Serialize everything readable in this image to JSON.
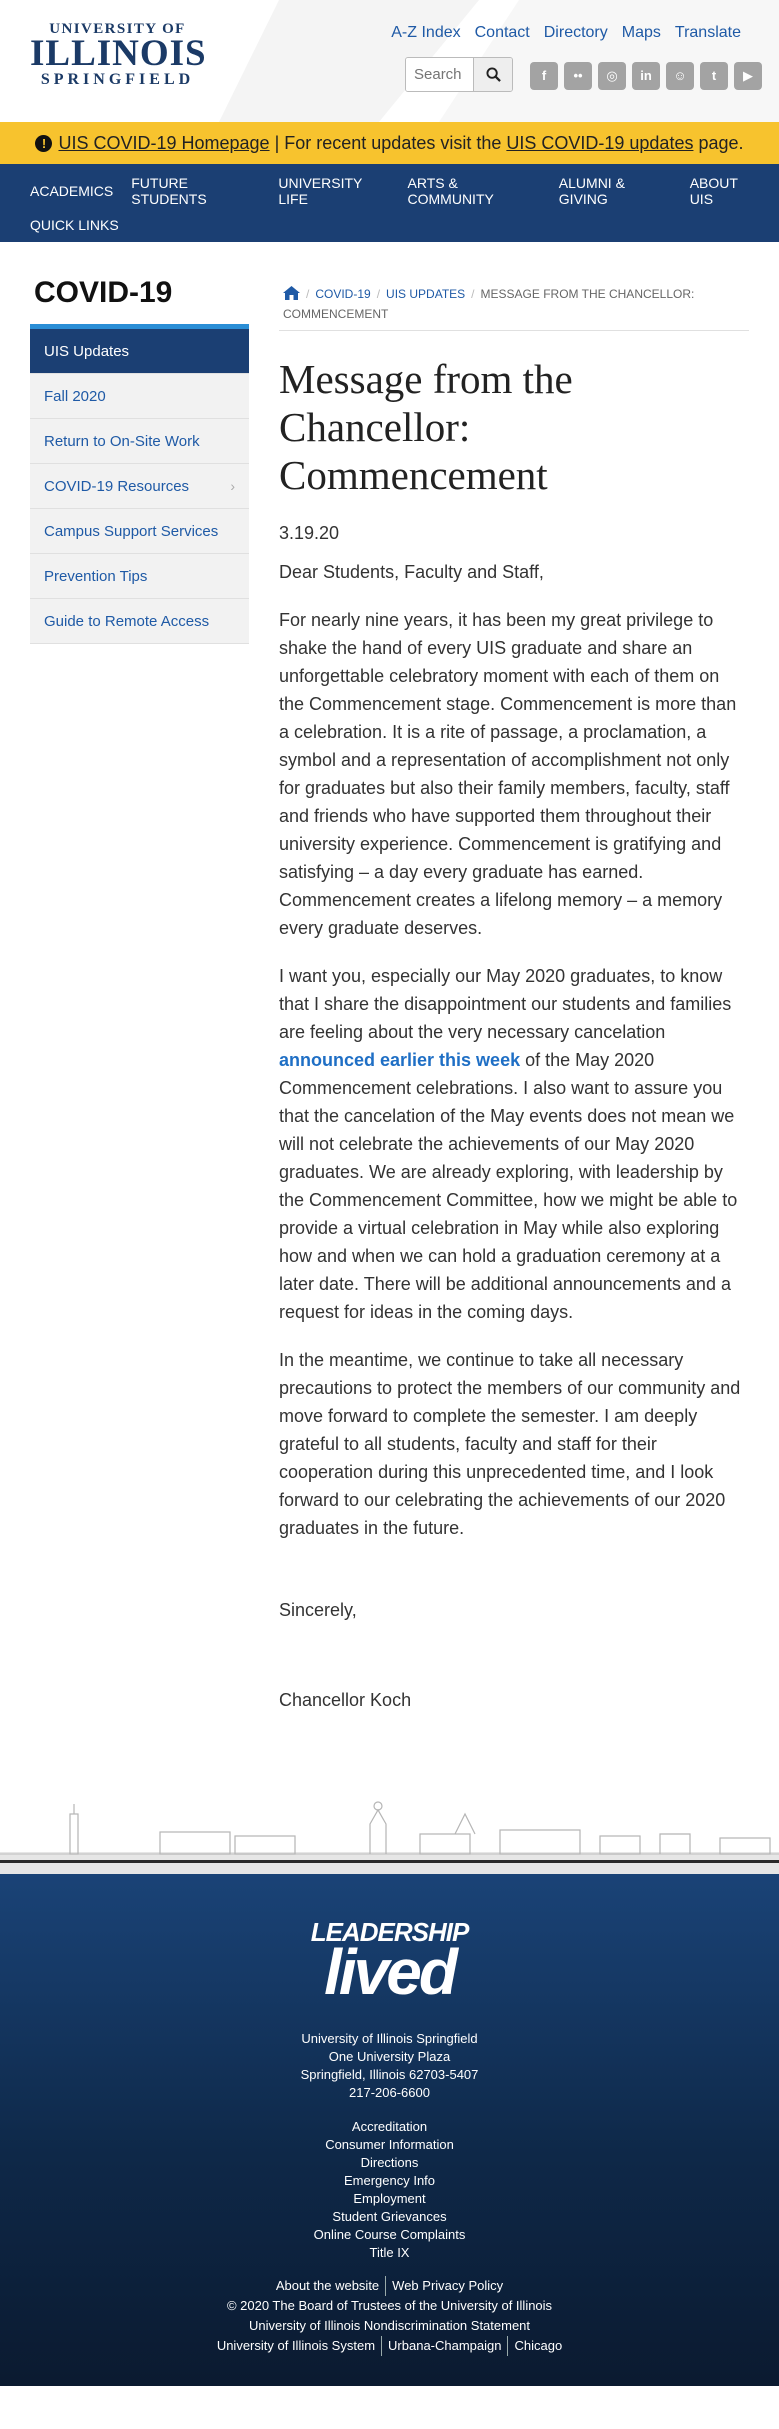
{
  "header": {
    "logo": {
      "line1": "UNIVERSITY OF",
      "line2": "ILLINOIS",
      "line3": "SPRINGFIELD"
    },
    "util_links": [
      "A-Z Index",
      "Contact",
      "Directory",
      "Maps",
      "Translate"
    ],
    "search": {
      "placeholder": "Search"
    },
    "social_icons": [
      "facebook-icon",
      "flickr-icon",
      "instagram-icon",
      "linkedin-icon",
      "snapchat-icon",
      "twitter-icon",
      "youtube-icon"
    ]
  },
  "alert": {
    "link1": "UIS COVID-19 Homepage",
    "mid": " | For recent updates visit the ",
    "link2": "UIS COVID-19 updates",
    "end": " page."
  },
  "mainnav": {
    "items": [
      "ACADEMICS",
      "FUTURE STUDENTS",
      "UNIVERSITY LIFE",
      "ARTS & COMMUNITY",
      "ALUMNI & GIVING",
      "ABOUT UIS"
    ],
    "quick": "QUICK LINKS"
  },
  "sidebar": {
    "title": "COVID-19",
    "items": [
      "UIS Updates",
      "Fall 2020",
      "Return to On-Site Work",
      "COVID-19 Resources",
      "Campus Support Services",
      "Prevention Tips",
      "Guide to Remote Access"
    ]
  },
  "breadcrumb": {
    "items": [
      "COVID-19",
      "UIS UPDATES"
    ],
    "current": "MESSAGE FROM THE CHANCELLOR: COMMENCEMENT"
  },
  "article": {
    "title": "Message from the Chancellor: Commencement",
    "date": "3.19.20",
    "greeting": "Dear Students, Faculty and Staff,",
    "p1": "For nearly nine years, it has been my great privilege to shake the hand of every UIS graduate and share an unforgettable celebratory moment with each of them on the Commencement stage. Commencement is more than a celebration. It is a rite of passage, a proclamation, a symbol and a representation of accomplishment not only for graduates but also their family members, faculty, staff and friends who have supported them throughout their university experience. Commencement is gratifying and satisfying – a day every graduate has earned. Commencement creates a lifelong memory – a memory every graduate deserves.",
    "p2_before": "I want you, especially our May 2020 graduates, to know that I share the disappointment our students and families are feeling about the very necessary cancelation ",
    "p2_link": "announced earlier this week",
    "p2_after": " of the May 2020 Commencement celebrations. I also want to assure you that the cancelation of the May events does not mean we will not celebrate the achievements of our May 2020 graduates. We are already exploring, with leadership by the Commencement Committee, how we might be able to provide a virtual celebration in May while also exploring how and when we can hold a graduation ceremony at a later date. There will be additional announcements and a request for ideas in the coming days.",
    "p3": "In the meantime, we continue to take all necessary precautions to protect the members of our community and move forward to complete the semester. I am deeply grateful to all students, faculty and staff for their cooperation during this unprecedented time, and I look forward to our celebrating the achievements of our 2020 graduates in the future.",
    "closing": "Sincerely,",
    "signature": "Chancellor Koch"
  },
  "footer": {
    "logo": {
      "line1": "LEADERSHIP",
      "line2": "lived"
    },
    "address": [
      "University of Illinois Springfield",
      "One University Plaza",
      "Springfield, Illinois 62703-5407",
      "217-206-6600"
    ],
    "links": [
      "Accreditation",
      "Consumer Information",
      "Directions",
      "Emergency Info",
      "Employment",
      "Student Grievances",
      "Online Course Complaints",
      "Title IX"
    ],
    "about": "About the website",
    "privacy": "Web Privacy Policy",
    "copyright": "© 2020 The Board of Trustees of the University of Illinois",
    "nondisc": "University of Illinois Nondiscrimination Statement",
    "system": [
      "University of Illinois System",
      "Urbana-Champaign",
      "Chicago"
    ]
  }
}
